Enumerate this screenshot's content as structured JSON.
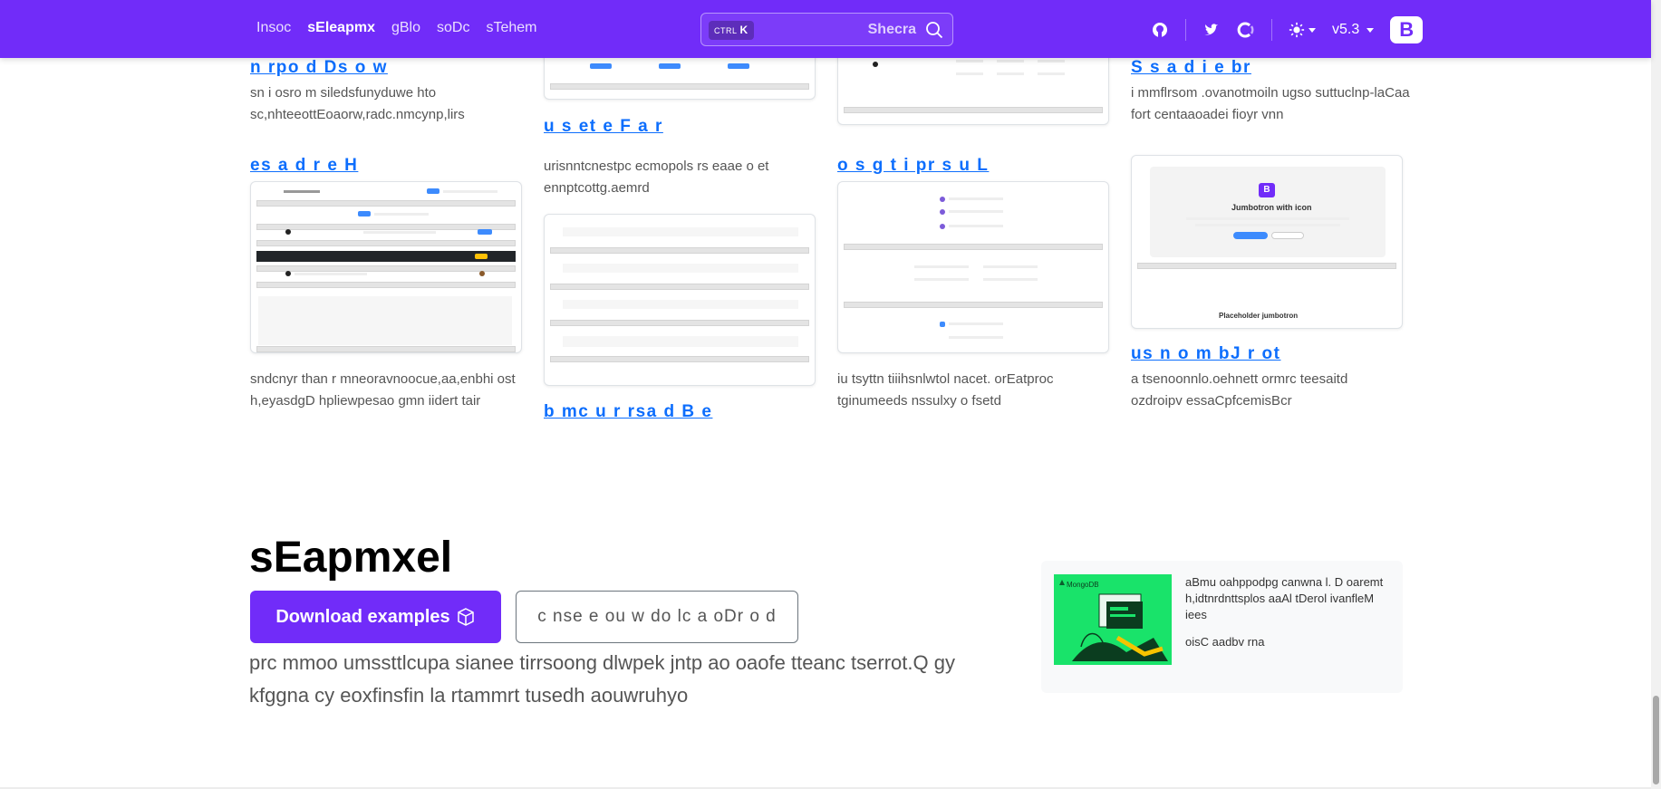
{
  "nav": {
    "links": [
      "Insoc",
      "sEleapmx",
      "gBlo",
      "soDc",
      "sTehem"
    ],
    "search": {
      "kbd_ctrl": "CTRL",
      "kbd_key": "K",
      "label": "Shecra"
    },
    "version": "v5.3",
    "brand": "B",
    "colors": {
      "navbar": "#712cf9"
    },
    "icons": [
      "github-icon",
      "twitter-icon",
      "opencollective-icon",
      "sun-icon",
      "bootstrap-logo-icon"
    ]
  },
  "cards": {
    "c1": {
      "link": "n rpo d Ds o w",
      "desc": "sn i osro m siledsfunyduwe hto sc,nhteeottEoaorw,radc.nmcynp,lirs"
    },
    "c2": {
      "link": "u s et e F a r",
      "desc": "urisnntcnestpc ecmopols rs eaae o et ennptcottg.aemrd"
    },
    "c3": {
      "link": "S s a d i e br",
      "desc": "i mmflrsom .ovanotmoiln ugso suttuclnp-laCaa fort centaaoadei fioyr vnn"
    },
    "c4": {
      "link": "es a d r e H",
      "desc": "sndcnyr than r mneoravnoocue,aa,enbhi ost h,eyasdgD hpliewpesao gmn iidert tair"
    },
    "c5": {
      "link": "o s g t i pr s u L",
      "desc": "iu tsyttn tiiihsnlwtol nacet. orEatproc tginumeeds nssulxy o fsetd"
    },
    "c6": {
      "link": "b mc u r rsa d B e"
    },
    "c7": {
      "link": "us n o m bJ r ot",
      "desc": "a tsenoonnlo.oehnett ormrc teesaitd ozdroipv essaCpfcemisBcr"
    }
  },
  "thumbs": {
    "jumbotron": {
      "title": "Jumbotron with icon",
      "placeholder": "Placeholder jumbotron",
      "logo": "B"
    }
  },
  "examples": {
    "title": "sEapmxel",
    "download_label": "Download examples",
    "outline_label": "c nse e ou w do lc a oDr o d",
    "lead": "prc mmoo umssttlcupa sianee tirrsoong dlwpek jntp ao oaofe tteanc tserrot.Q gy kfggna cy eoxfinsfin la rtammrt tusedh aouwruhyo"
  },
  "ad": {
    "brand": "MongoDB",
    "text": "aBmu oahppodpg canwna l. D oaremt h,idtnrdnttsplos aaAl tDerol ivanfleM iees",
    "sub": "oisC aadbv rna",
    "colors": {
      "background": "#19e36a"
    }
  }
}
